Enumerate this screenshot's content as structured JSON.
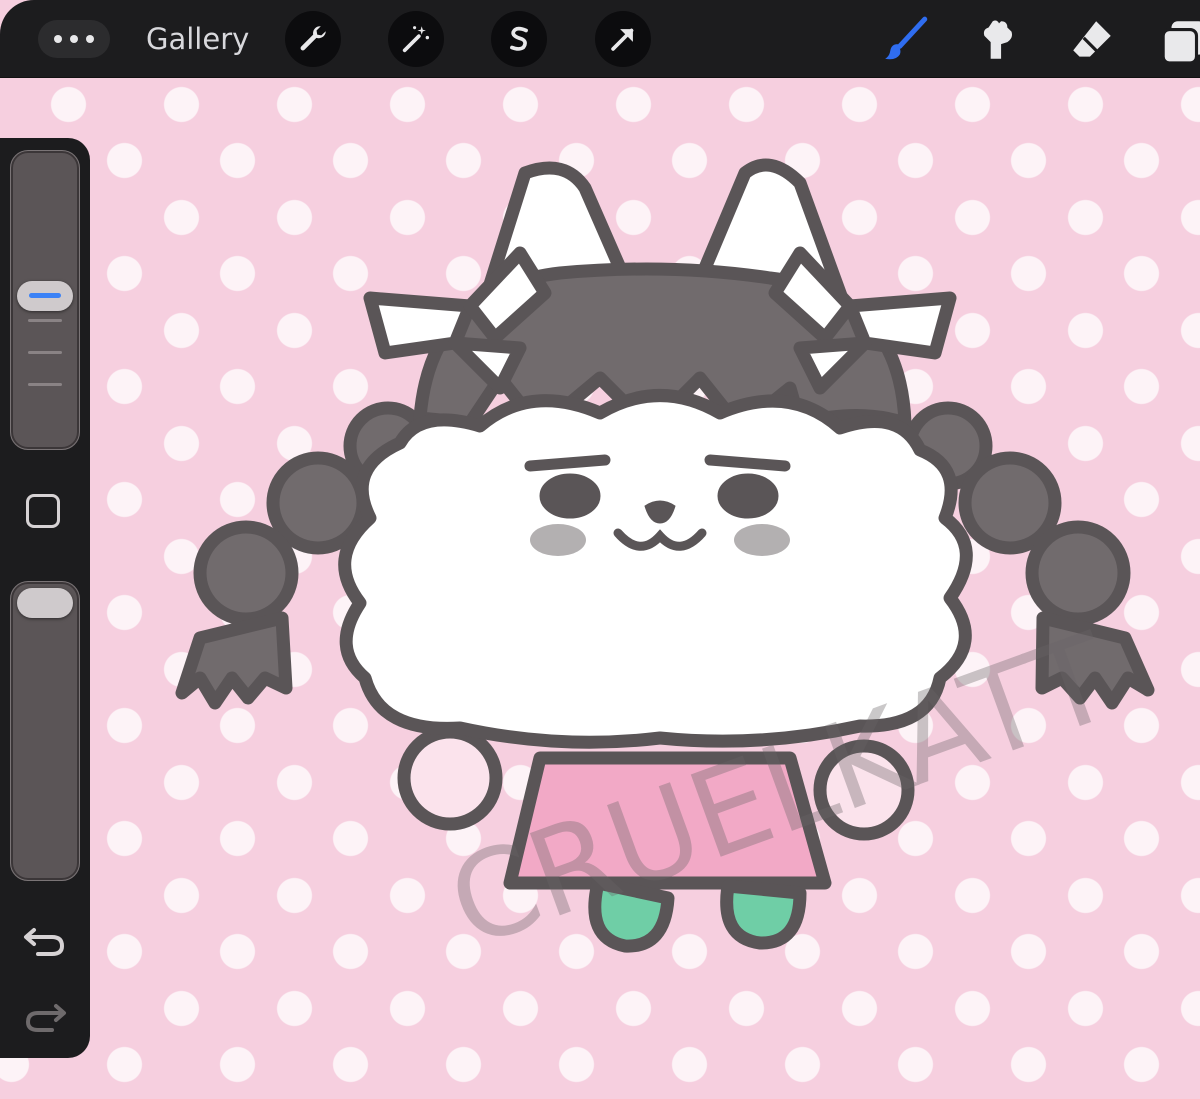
{
  "toolbar": {
    "gallery_label": "Gallery",
    "left_tools": [
      "wrench-icon",
      "magic-wand-icon",
      "selection-s-icon",
      "transform-arrow-icon"
    ],
    "right_tools": [
      "brush-icon",
      "smudge-icon",
      "eraser-icon",
      "layers-icon"
    ],
    "active_tool": "brush-icon",
    "active_color": "#2f6df0"
  },
  "sidebar": {
    "brush_size_level": 0.55,
    "opacity_level": 0.95,
    "tools": [
      "modify-square-icon",
      "undo-icon",
      "redo-icon"
    ]
  },
  "canvas": {
    "background_color": "#f6cfdf",
    "dot_color": "#ffffff",
    "watermark_text": "CRUELKATT"
  }
}
